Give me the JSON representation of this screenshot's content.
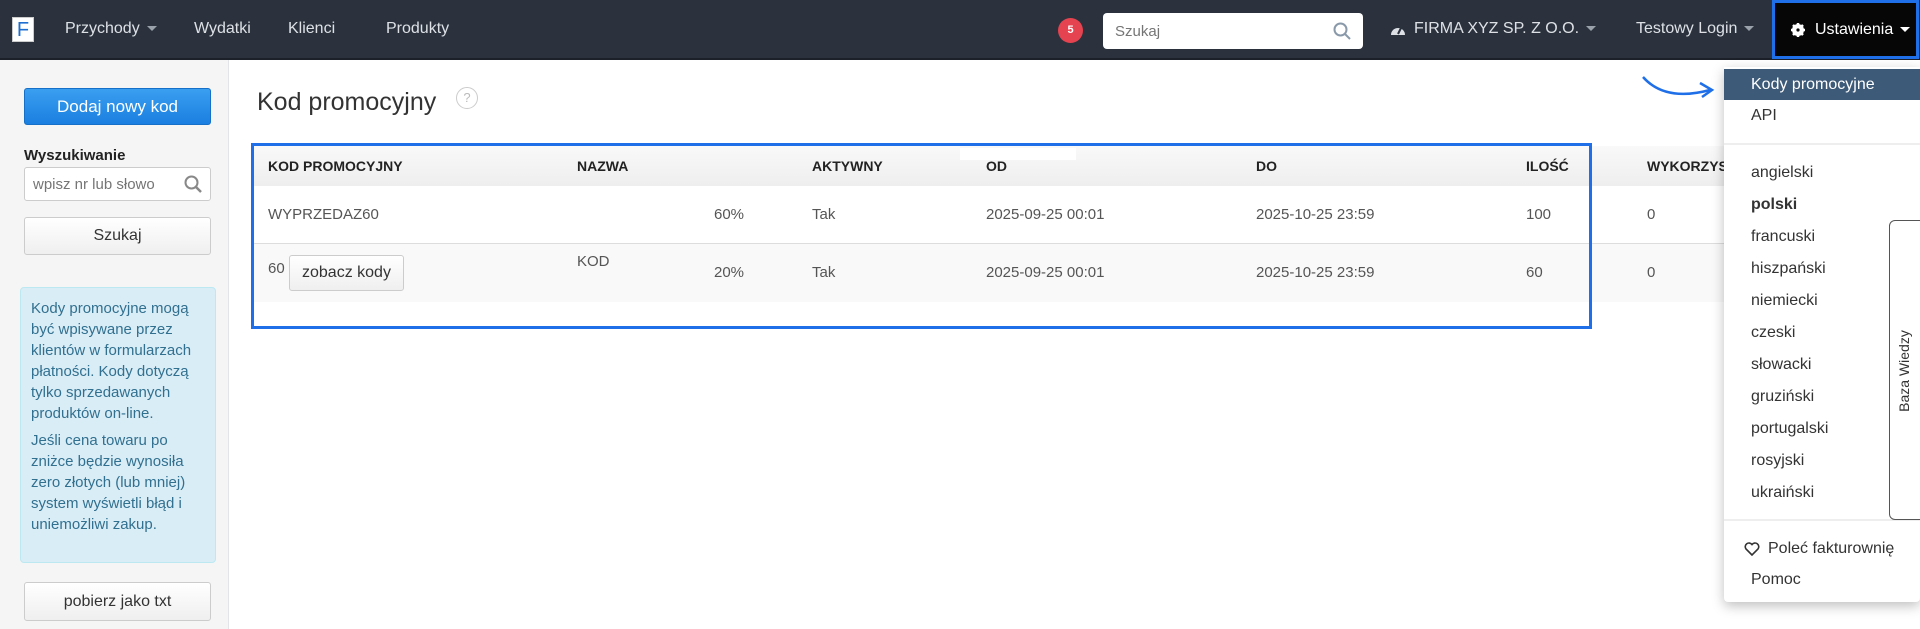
{
  "nav": {
    "logo": "F",
    "items": [
      "Przychody",
      "Wydatki",
      "Klienci",
      "Produkty"
    ],
    "badge": "5",
    "search_placeholder": "Szukaj",
    "company": "FIRMA XYZ SP. Z O.O.",
    "user": "Testowy Login",
    "settings": "Ustawienia"
  },
  "sidebar": {
    "add_button": "Dodaj nowy kod",
    "search_label": "Wyszukiwanie",
    "search_placeholder": "wpisz nr lub słowo",
    "search_button": "Szukaj",
    "info": [
      "Kody promocyjne mogą być wpisywane przez klientów w formularzach płatności. Kody dotyczą tylko sprzedawanych produktów on-line.",
      "Jeśli cena towaru po zniżce będzie wynosiła zero złotych (lub mniej) system wyświetli błąd i uniemożliwi zakup."
    ],
    "download_button": "pobierz jako txt"
  },
  "main": {
    "title": "Kod promocyjny",
    "help": "?",
    "columns": [
      "KOD PROMOCYJNY",
      "NAZWA",
      "AKTYWNY",
      "OD",
      "DO",
      "ILOŚĆ",
      "WYKORZYS"
    ],
    "rows": [
      {
        "code": "WYPRZEDAZ60",
        "name": "",
        "discount": "60%",
        "active": "Tak",
        "from": "2025-09-25 00:01",
        "to": "2025-10-25 23:59",
        "qty": "100",
        "used": "0"
      },
      {
        "code": "60",
        "button": "zobacz kody",
        "name": "KOD",
        "discount": "20%",
        "active": "Tak",
        "from": "2025-09-25 00:01",
        "to": "2025-10-25 23:59",
        "qty": "60",
        "used": "0"
      }
    ]
  },
  "dropdown": {
    "items": [
      "Kody promocyjne",
      "API"
    ],
    "languages": [
      "angielski",
      "polski",
      "francuski",
      "hiszpański",
      "niemiecki",
      "czeski",
      "słowacki",
      "gruziński",
      "portugalski",
      "rosyjski",
      "ukraiński"
    ],
    "selected_language": "polski",
    "recommend": "Poleć fakturownię",
    "help": "Pomoc"
  },
  "knowledge_tab": "Baza Wiedzy",
  "colors": {
    "navbar": "#2b323d",
    "highlight": "#1f6fe8",
    "active_menu": "#3d5a78",
    "primary": "#1a7fe0"
  }
}
